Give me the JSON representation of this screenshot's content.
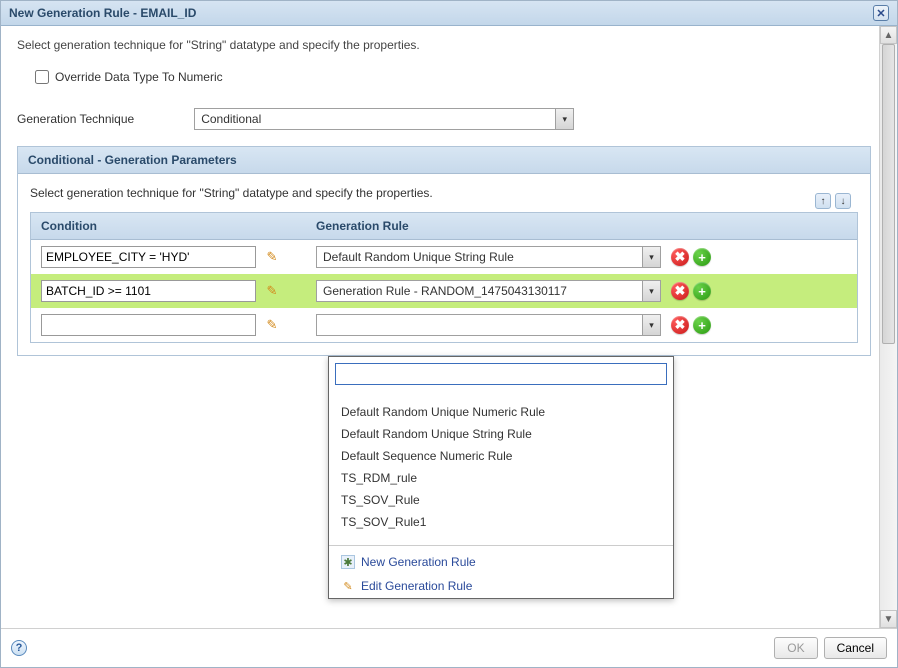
{
  "title": "New Generation Rule - EMAIL_ID",
  "intro": "Select generation technique for \"String\" datatype and specify the properties.",
  "override_label": "Override Data Type To Numeric",
  "technique_label": "Generation Technique",
  "technique_value": "Conditional",
  "panel_title": "Conditional - Generation Parameters",
  "panel_intro": "Select generation technique for \"String\" datatype and specify the properties.",
  "columns": {
    "condition": "Condition",
    "generation": "Generation Rule"
  },
  "rows": [
    {
      "condition": "EMPLOYEE_CITY = 'HYD'",
      "rule": "Default Random Unique String Rule"
    },
    {
      "condition": "BATCH_ID >= 1101",
      "rule": "Generation Rule - RANDOM_1475043130117"
    },
    {
      "condition": "",
      "rule": ""
    }
  ],
  "dropdown": {
    "search": "",
    "options": [
      "Default Random Unique Numeric Rule",
      "Default Random Unique String Rule",
      "Default Sequence Numeric Rule",
      "TS_RDM_rule",
      "TS_SOV_Rule",
      "TS_SOV_Rule1"
    ],
    "new_rule": "New Generation Rule",
    "edit_rule": "Edit Generation Rule"
  },
  "footer": {
    "ok": "OK",
    "cancel": "Cancel"
  }
}
